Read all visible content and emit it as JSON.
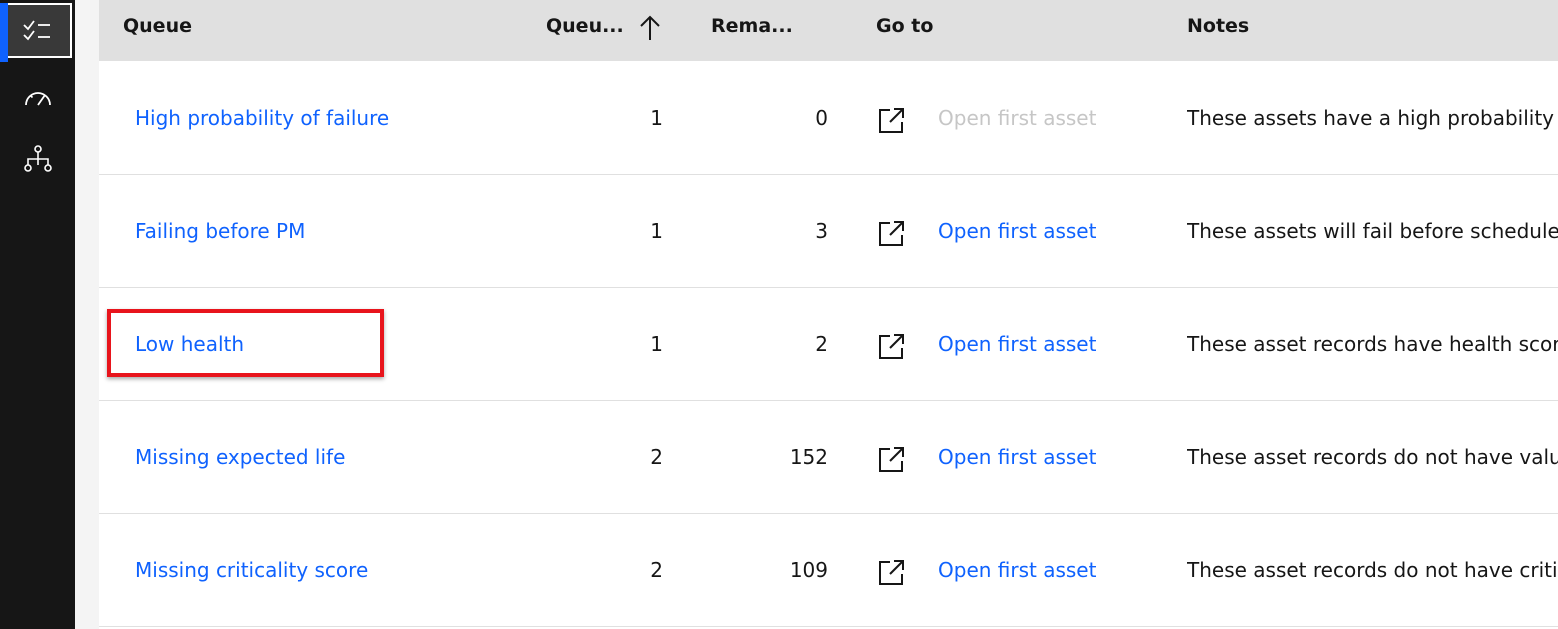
{
  "sidenav": {
    "items": [
      {
        "icon": "task-list-icon",
        "active": true
      },
      {
        "icon": "dashboard-gauge-icon",
        "active": false
      },
      {
        "icon": "hierarchy-icon",
        "active": false
      }
    ],
    "accent_color": "#0f62fe"
  },
  "table": {
    "headers": {
      "queue": "Queue",
      "queue_count": "Queu...",
      "remaining": "Rema...",
      "go_to": "Go to",
      "notes": "Notes"
    },
    "sort": {
      "column": "queue_count",
      "direction": "ascending",
      "icon": "arrow-up-icon"
    },
    "rows": [
      {
        "queue": "High probability of failure",
        "queue_count": "1",
        "remaining": "0",
        "go_to_label": "Open first asset",
        "go_to_enabled": false,
        "notes": "These assets have a high probability of"
      },
      {
        "queue": "Failing before PM",
        "queue_count": "1",
        "remaining": "3",
        "go_to_label": "Open first asset",
        "go_to_enabled": true,
        "notes": "These assets will fail before scheduled"
      },
      {
        "queue": "Low health",
        "queue_count": "1",
        "remaining": "2",
        "go_to_label": "Open first asset",
        "go_to_enabled": true,
        "notes": "These asset records have health scores"
      },
      {
        "queue": "Missing expected life",
        "queue_count": "2",
        "remaining": "152",
        "go_to_label": "Open first asset",
        "go_to_enabled": true,
        "notes": "These asset records do not have values"
      },
      {
        "queue": "Missing criticality score",
        "queue_count": "2",
        "remaining": "109",
        "go_to_label": "Open first asset",
        "go_to_enabled": true,
        "notes": "These asset records do not have critica"
      }
    ]
  },
  "highlight": {
    "target_row": 2,
    "color": "#e8141c"
  },
  "colors": {
    "link": "#0f62fe",
    "disabled": "#c6c6c6",
    "header_bg": "#e0e0e0",
    "nav_bg": "#161616"
  }
}
